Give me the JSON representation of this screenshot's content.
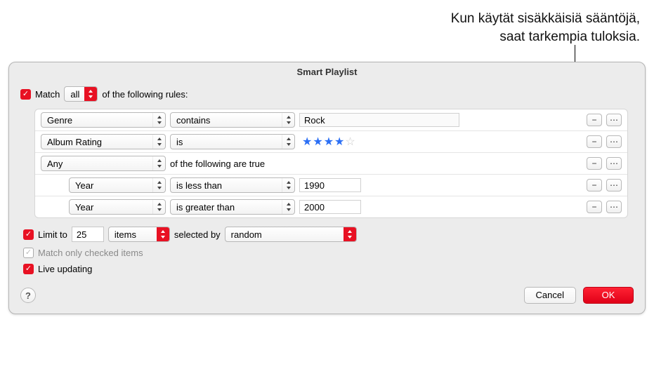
{
  "annotation": {
    "line1": "Kun käytät sisäkkäisiä sääntöjä,",
    "line2": "saat tarkempia tuloksia."
  },
  "dialog": {
    "title": "Smart Playlist",
    "match": {
      "prefix": "Match",
      "mode": "all",
      "suffix": "of the following rules:"
    },
    "rules": [
      {
        "field": "Genre",
        "op": "contains",
        "value": "Rock",
        "type": "text"
      },
      {
        "field": "Album Rating",
        "op": "is",
        "stars": 4,
        "max_stars": 5,
        "type": "stars"
      },
      {
        "field": "Any",
        "suffix": "of the following are true",
        "type": "group"
      },
      {
        "field": "Year",
        "op": "is less than",
        "value": "1990",
        "type": "nested"
      },
      {
        "field": "Year",
        "op": "is greater than",
        "value": "2000",
        "type": "nested"
      }
    ],
    "limit": {
      "label": "Limit to",
      "count": "25",
      "unit": "items",
      "by_label": "selected by",
      "by": "random"
    },
    "match_checked": {
      "label": "Match only checked items",
      "checked": true,
      "disabled": true
    },
    "live": {
      "label": "Live updating",
      "checked": true
    },
    "buttons": {
      "help": "?",
      "cancel": "Cancel",
      "ok": "OK"
    },
    "icons": {
      "minus": "−",
      "more": "⋯"
    }
  }
}
